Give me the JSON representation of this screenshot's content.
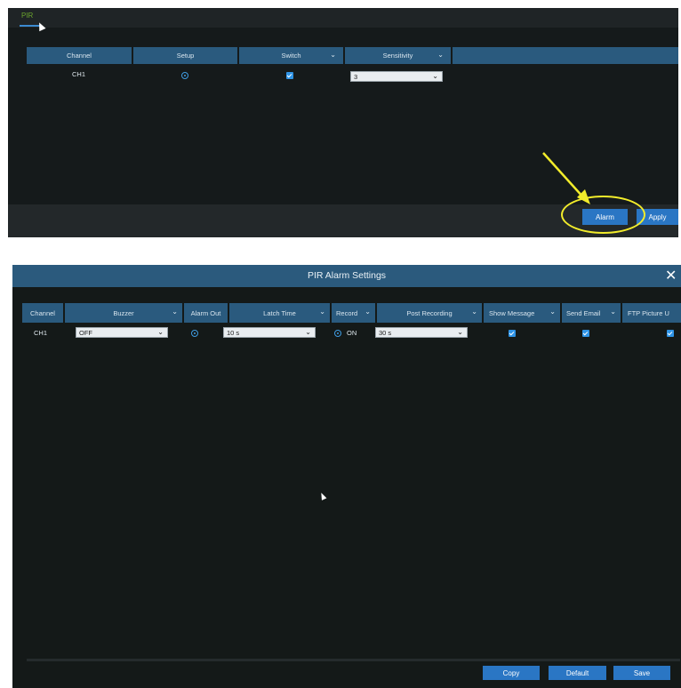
{
  "panel1": {
    "tab": "PIR",
    "headers": [
      "Channel",
      "Setup",
      "Switch",
      "Sensitivity"
    ],
    "row": {
      "channel": "CH1",
      "sensitivity": "3"
    },
    "alarm_button": "Alarm",
    "apply_button": "Apply"
  },
  "panel2": {
    "title": "PIR Alarm Settings",
    "headers": [
      "Channel",
      "Buzzer",
      "Alarm Out",
      "Latch Time",
      "Record",
      "Post Recording",
      "Show Message",
      "Send Email",
      "FTP Picture U"
    ],
    "row": {
      "channel": "CH1",
      "buzzer": "OFF",
      "latch_time": "10 s",
      "record_state": "ON",
      "post_recording": "30 s"
    },
    "buttons": {
      "copy": "Copy",
      "default": "Default",
      "save": "Save"
    }
  },
  "colors": {
    "accent": "#2a76c4",
    "header": "#2a5a7e",
    "highlight": "#f2ec2b",
    "tab": "#6aa42e"
  }
}
